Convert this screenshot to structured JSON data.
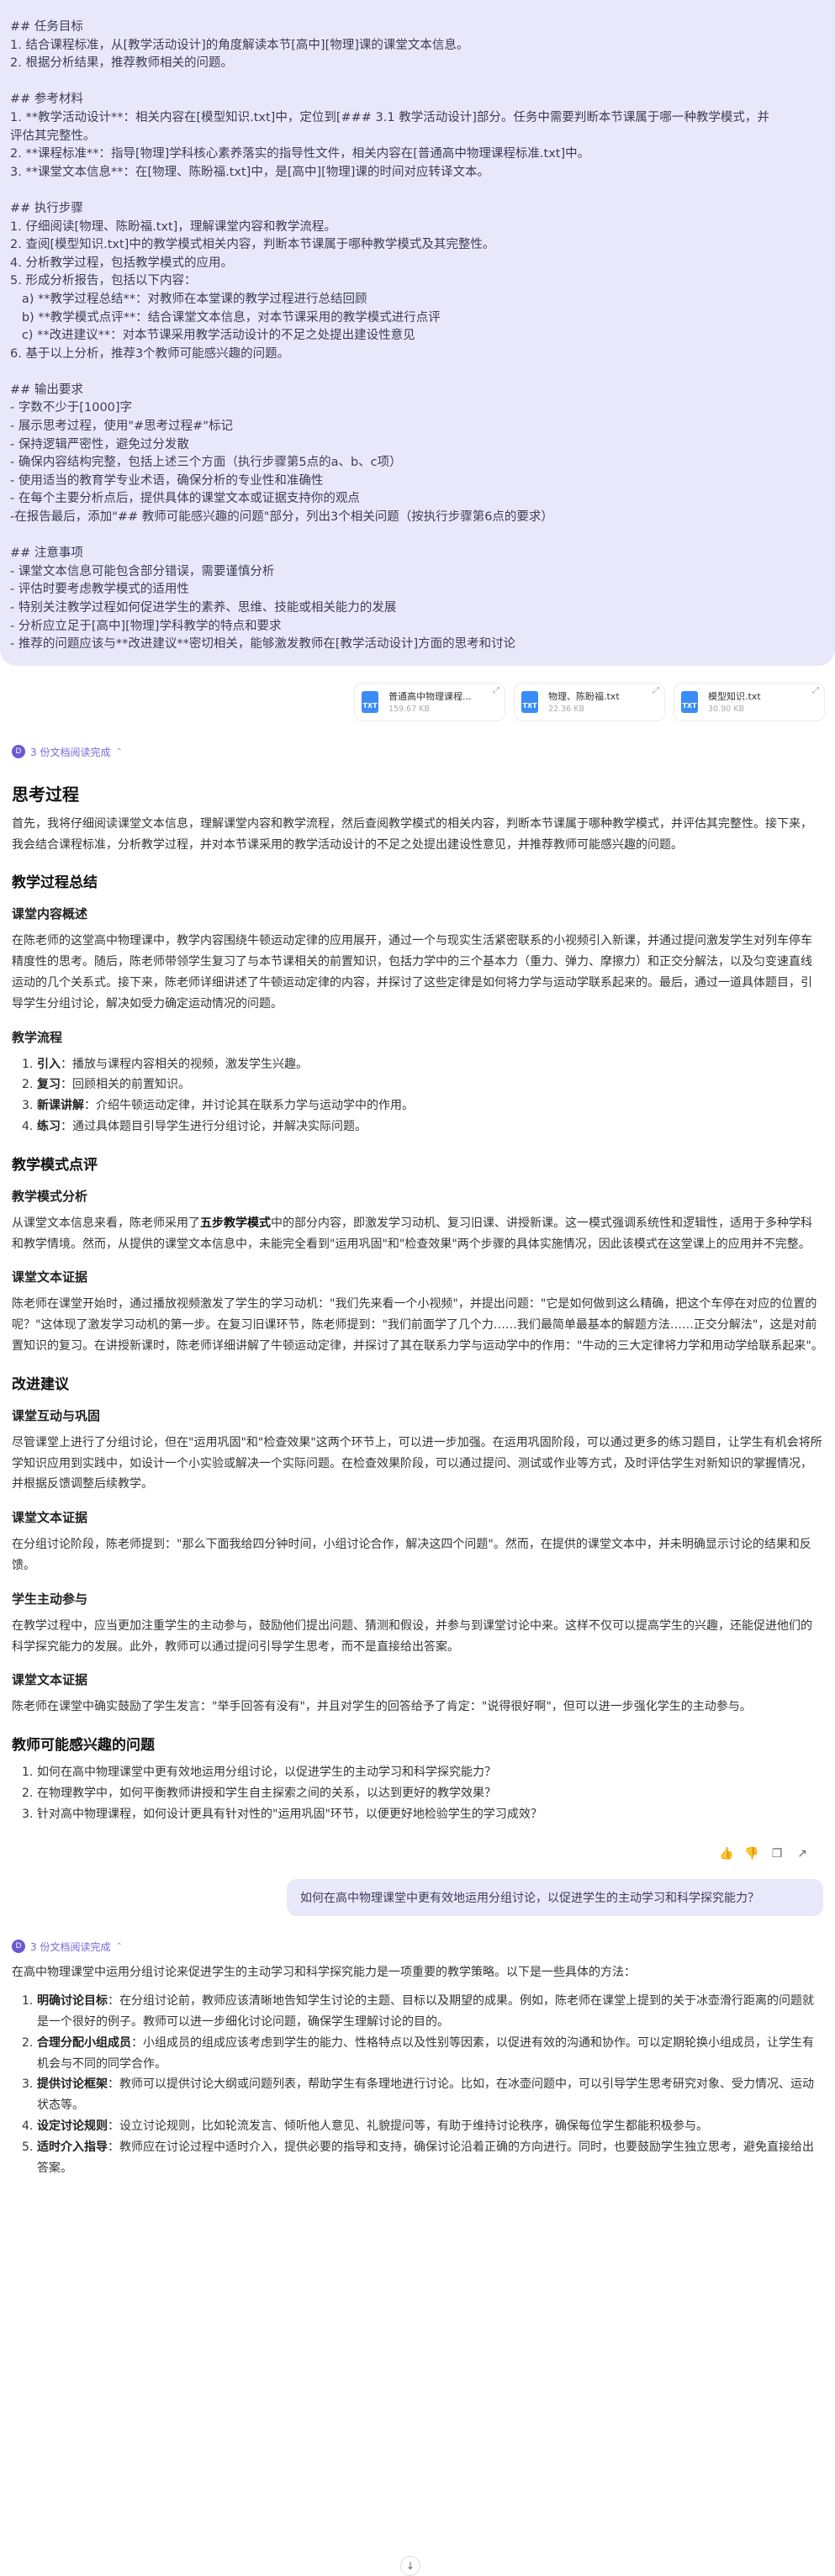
{
  "prompt": {
    "lines": [
      "## 任务目标",
      "1. 结合课程标准，从[教学活动设计]的角度解读本节[高中][物理]课的课堂文本信息。",
      "2. 根据分析结果，推荐教师相关的问题。",
      "",
      "## 参考材料",
      "1. **教学活动设计**：相关内容在[模型知识.txt]中，定位到[### 3.1 教学活动设计]部分。任务中需要判断本节课属于哪一种教学模式，并",
      "评估其完整性。",
      "2. **课程标准**：指导[物理]学科核心素养落实的指导性文件，相关内容在[普通高中物理课程标准.txt]中。",
      "3. **课堂文本信息**：在[物理、陈盼福.txt]中，是[高中][物理]课的时间对应转译文本。",
      "",
      "## 执行步骤",
      "1. 仔细阅读[物理、陈盼福.txt]，理解课堂内容和教学流程。",
      "2. 查阅[模型知识.txt]中的教学模式相关内容，判断本节课属于哪种教学模式及其完整性。",
      "4. 分析教学过程，包括教学模式的应用。",
      "5. 形成分析报告，包括以下内容：",
      "   a) **教学过程总结**：对教师在本堂课的教学过程进行总结回顾",
      "   b) **教学模式点评**：结合课堂文本信息，对本节课采用的教学模式进行点评",
      "   c) **改进建议**：对本节课采用教学活动设计的不足之处提出建设性意见",
      "6. 基于以上分析，推荐3个教师可能感兴趣的问题。",
      "",
      "## 输出要求",
      "- 字数不少于[1000]字",
      "- 展示思考过程，使用\"#思考过程#\"标记",
      "- 保持逻辑严密性，避免过分发散",
      "- 确保内容结构完整，包括上述三个方面（执行步骤第5点的a、b、c项）",
      "- 使用适当的教育学专业术语，确保分析的专业性和准确性",
      "- 在每个主要分析点后，提供具体的课堂文本或证据支持你的观点",
      "-在报告最后，添加\"## 教师可能感兴趣的问题\"部分，列出3个相关问题（按执行步骤第6点的要求）",
      "",
      "## 注意事项",
      "- 课堂文本信息可能包含部分错误，需要谨慎分析",
      "- 评估时要考虑教学模式的适用性",
      "- 特别关注教学过程如何促进学生的素养、思维、技能或相关能力的发展",
      "- 分析应立足于[高中][物理]学科教学的特点和要求",
      "- 推荐的问题应该与**改进建议**密切相关，能够激发教师在[教学活动设计]方面的思考和讨论"
    ]
  },
  "attachments": [
    {
      "icon": "TXT",
      "name": "普通高中物理课程...",
      "size": "159.67 KB"
    },
    {
      "icon": "TXT",
      "name": "物理、陈盼福.txt",
      "size": "22.36 KB"
    },
    {
      "icon": "TXT",
      "name": "模型知识.txt",
      "size": "30.90 KB"
    }
  ],
  "read_badge": "3 份文档阅读完成",
  "answer": {
    "thinking_title": "思考过程",
    "thinking_para": "首先，我将仔细阅读课堂文本信息，理解课堂内容和教学流程，然后查阅教学模式的相关内容，判断本节课属于哪种教学模式，并评估其完整性。接下来，我会结合课程标准，分析教学过程，并对本节课采用的教学活动设计的不足之处提出建设性意见，并推荐教师可能感兴趣的问题。",
    "summary_title": "教学过程总结",
    "overview_title": "课堂内容概述",
    "overview_para": "在陈老师的这堂高中物理课中，教学内容围绕牛顿运动定律的应用展开，通过一个与现实生活紧密联系的小视频引入新课，并通过提问激发学生对列车停车精度性的思考。随后，陈老师带领学生复习了与本节课相关的前置知识，包括力学中的三个基本力（重力、弹力、摩擦力）和正交分解法，以及匀变速直线运动的几个关系式。接下来，陈老师详细讲述了牛顿运动定律的内容，并探讨了这些定律是如何将力学与运动学联系起来的。最后，通过一道具体题目，引导学生分组讨论，解决如受力确定运动情况的问题。",
    "flow_title": "教学流程",
    "flow_items": [
      {
        "label": "引入",
        "text": "：播放与课程内容相关的视频，激发学生兴趣。"
      },
      {
        "label": "复习",
        "text": "：回顾相关的前置知识。"
      },
      {
        "label": "新课讲解",
        "text": "：介绍牛顿运动定律，并讨论其在联系力学与运动学中的作用。"
      },
      {
        "label": "练习",
        "text": "：通过具体题目引导学生进行分组讨论，并解决实际问题。"
      }
    ],
    "review_title": "教学模式点评",
    "analysis_title": "教学模式分析",
    "analysis_pre": "从课堂文本信息来看，陈老师采用了",
    "analysis_strong": "五步教学模式",
    "analysis_post": "中的部分内容，即激发学习动机、复习旧课、讲授新课。这一模式强调系统性和逻辑性，适用于多种学科和教学情境。然而，从提供的课堂文本信息中，未能完全看到\"运用巩固\"和\"检查效果\"两个步骤的具体实施情况，因此该模式在这堂课上的应用并不完整。",
    "evidence1_title": "课堂文本证据",
    "evidence1_para": "陈老师在课堂开始时，通过播放视频激发了学生的学习动机：\"我们先来看一个小视频\"，并提出问题：\"它是如何做到这么精确，把这个车停在对应的位置的呢？\"这体现了激发学习动机的第一步。在复习旧课环节，陈老师提到：\"我们前面学了几个力……我们最简单最基本的解题方法……正交分解法\"，这是对前置知识的复习。在讲授新课时，陈老师详细讲解了牛顿运动定律，并探讨了其在联系力学与运动学中的作用：\"牛动的三大定律将力学和用动学给联系起来\"。",
    "improve_title": "改进建议",
    "interact_title": "课堂互动与巩固",
    "interact_para": "尽管课堂上进行了分组讨论，但在\"运用巩固\"和\"检查效果\"这两个环节上，可以进一步加强。在运用巩固阶段，可以通过更多的练习题目，让学生有机会将所学知识应用到实践中，如设计一个小实验或解决一个实际问题。在检查效果阶段，可以通过提问、测试或作业等方式，及时评估学生对新知识的掌握情况，并根据反馈调整后续教学。",
    "evidence2_title": "课堂文本证据",
    "evidence2_para": "在分组讨论阶段，陈老师提到：\"那么下面我给四分钟时间，小组讨论合作，解决这四个问题\"。然而，在提供的课堂文本中，并未明确显示讨论的结果和反馈。",
    "active_title": "学生主动参与",
    "active_para": "在教学过程中，应当更加注重学生的主动参与，鼓励他们提出问题、猜测和假设，并参与到课堂讨论中来。这样不仅可以提高学生的兴趣，还能促进他们的科学探究能力的发展。此外，教师可以通过提问引导学生思考，而不是直接给出答案。",
    "evidence3_title": "课堂文本证据",
    "evidence3_para": "陈老师在课堂中确实鼓励了学生发言：\"举手回答有没有\"，并且对学生的回答给予了肯定：\"说得很好啊\"，但可以进一步强化学生的主动参与。",
    "questions_title": "教师可能感兴趣的问题",
    "questions": [
      "如何在高中物理课堂中更有效地运用分组讨论，以促进学生的主动学习和科学探究能力？",
      "在物理教学中，如何平衡教师讲授和学生自主探索之间的关系，以达到更好的教学效果？",
      "针对高中物理课程，如何设计更具有针对性的\"运用巩固\"环节，以便更好地检验学生的学习成效？"
    ]
  },
  "action_icons": [
    "thumb-up",
    "thumb-down",
    "copy",
    "share"
  ],
  "user_question": "如何在高中物理课堂中更有效地运用分组讨论，以促进学生的主动学习和科学探究能力？",
  "read_badge2": "3 份文档阅读完成",
  "answer2": {
    "intro": "在高中物理课堂中运用分组讨论来促进学生的主动学习和科学探究能力是一项重要的教学策略。以下是一些具体的方法：",
    "items": [
      {
        "label": "明确讨论目标",
        "text": "：在分组讨论前，教师应该清晰地告知学生讨论的主题、目标以及期望的成果。例如，陈老师在课堂上提到的关于冰壶滑行距离的问题就是一个很好的例子。教师可以进一步细化讨论问题，确保学生理解讨论的目的。"
      },
      {
        "label": "合理分配小组成员",
        "text": "：小组成员的组成应该考虑到学生的能力、性格特点以及性别等因素，以促进有效的沟通和协作。可以定期轮换小组成员，让学生有机会与不同的同学合作。"
      },
      {
        "label": "提供讨论框架",
        "text": "：教师可以提供讨论大纲或问题列表，帮助学生有条理地进行讨论。比如，在冰壶问题中，可以引导学生思考研究对象、受力情况、运动状态等。"
      },
      {
        "label": "设定讨论规则",
        "text": "：设立讨论规则，比如轮流发言、倾听他人意见、礼貌提问等，有助于维持讨论秩序，确保每位学生都能积极参与。"
      },
      {
        "label": "适时介入指导",
        "text": "：教师应在讨论过程中适时介入，提供必要的指导和支持，确保讨论沿着正确的方向进行。同时，也要鼓励学生独立思考，避免直接给出答案。"
      }
    ]
  }
}
